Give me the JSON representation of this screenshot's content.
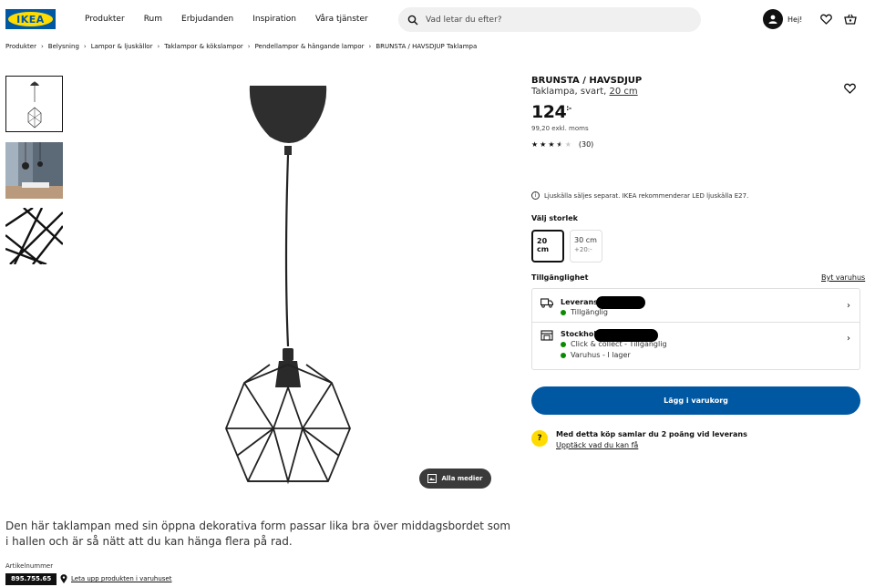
{
  "header": {
    "logo_text": "IKEA",
    "nav": [
      "Produkter",
      "Rum",
      "Erbjudanden",
      "Inspiration",
      "Våra tjänster"
    ],
    "search_placeholder": "Vad letar du efter?",
    "greeting": "Hej!"
  },
  "breadcrumb": [
    "Produkter",
    "Belysning",
    "Lampor & ljuskällor",
    "Taklampor & kökslampor",
    "Pendellampor & hängande lampor",
    "BRUNSTA / HAVSDJUP Taklampa"
  ],
  "media": {
    "all_media_label": "Alla medier"
  },
  "product": {
    "name": "BRUNSTA / HAVSDJUP",
    "desc_prefix": "Taklampa, svart, ",
    "desc_size": "20 cm",
    "price": "124",
    "price_suffix": ":-",
    "exkl": "99,20 exkl. moms",
    "rating": 3.5,
    "reviews": "(30)",
    "notice": "Ljuskälla säljes separat. IKEA rekommenderar LED ljuskälla E27.",
    "size_heading": "Välj storlek",
    "sizes": [
      {
        "label": "20 cm",
        "extra": ""
      },
      {
        "label": "30 cm",
        "extra": "+20:-"
      }
    ],
    "description": "Den här taklampan med sin öppna dekorativa form passar lika bra över middagsbordet som i hallen och är så nätt att du kan hänga flera på rad.",
    "article_label": "Artikelnummer",
    "article_number": "895.755.65",
    "find_in_store": "Leta upp produkten i varuhuset"
  },
  "availability": {
    "heading": "Tillgänglighet",
    "change_store": "Byt varuhus",
    "delivery_title": "Leverans ti",
    "delivery_status": "Tillgänglig",
    "store_title": "Stockholm",
    "store_status_1": "Click & collect - Tillgänglig",
    "store_status_2": "Varuhus - I lager"
  },
  "cart": {
    "add_label": "Lägg i varukorg"
  },
  "family": {
    "text": "Med detta köp samlar du 2 poäng vid leverans",
    "link": "Upptäck vad du kan få"
  },
  "colors": {
    "brand_blue": "#0058a3",
    "brand_yellow": "#ffdb00",
    "available_green": "#0a8a00"
  }
}
